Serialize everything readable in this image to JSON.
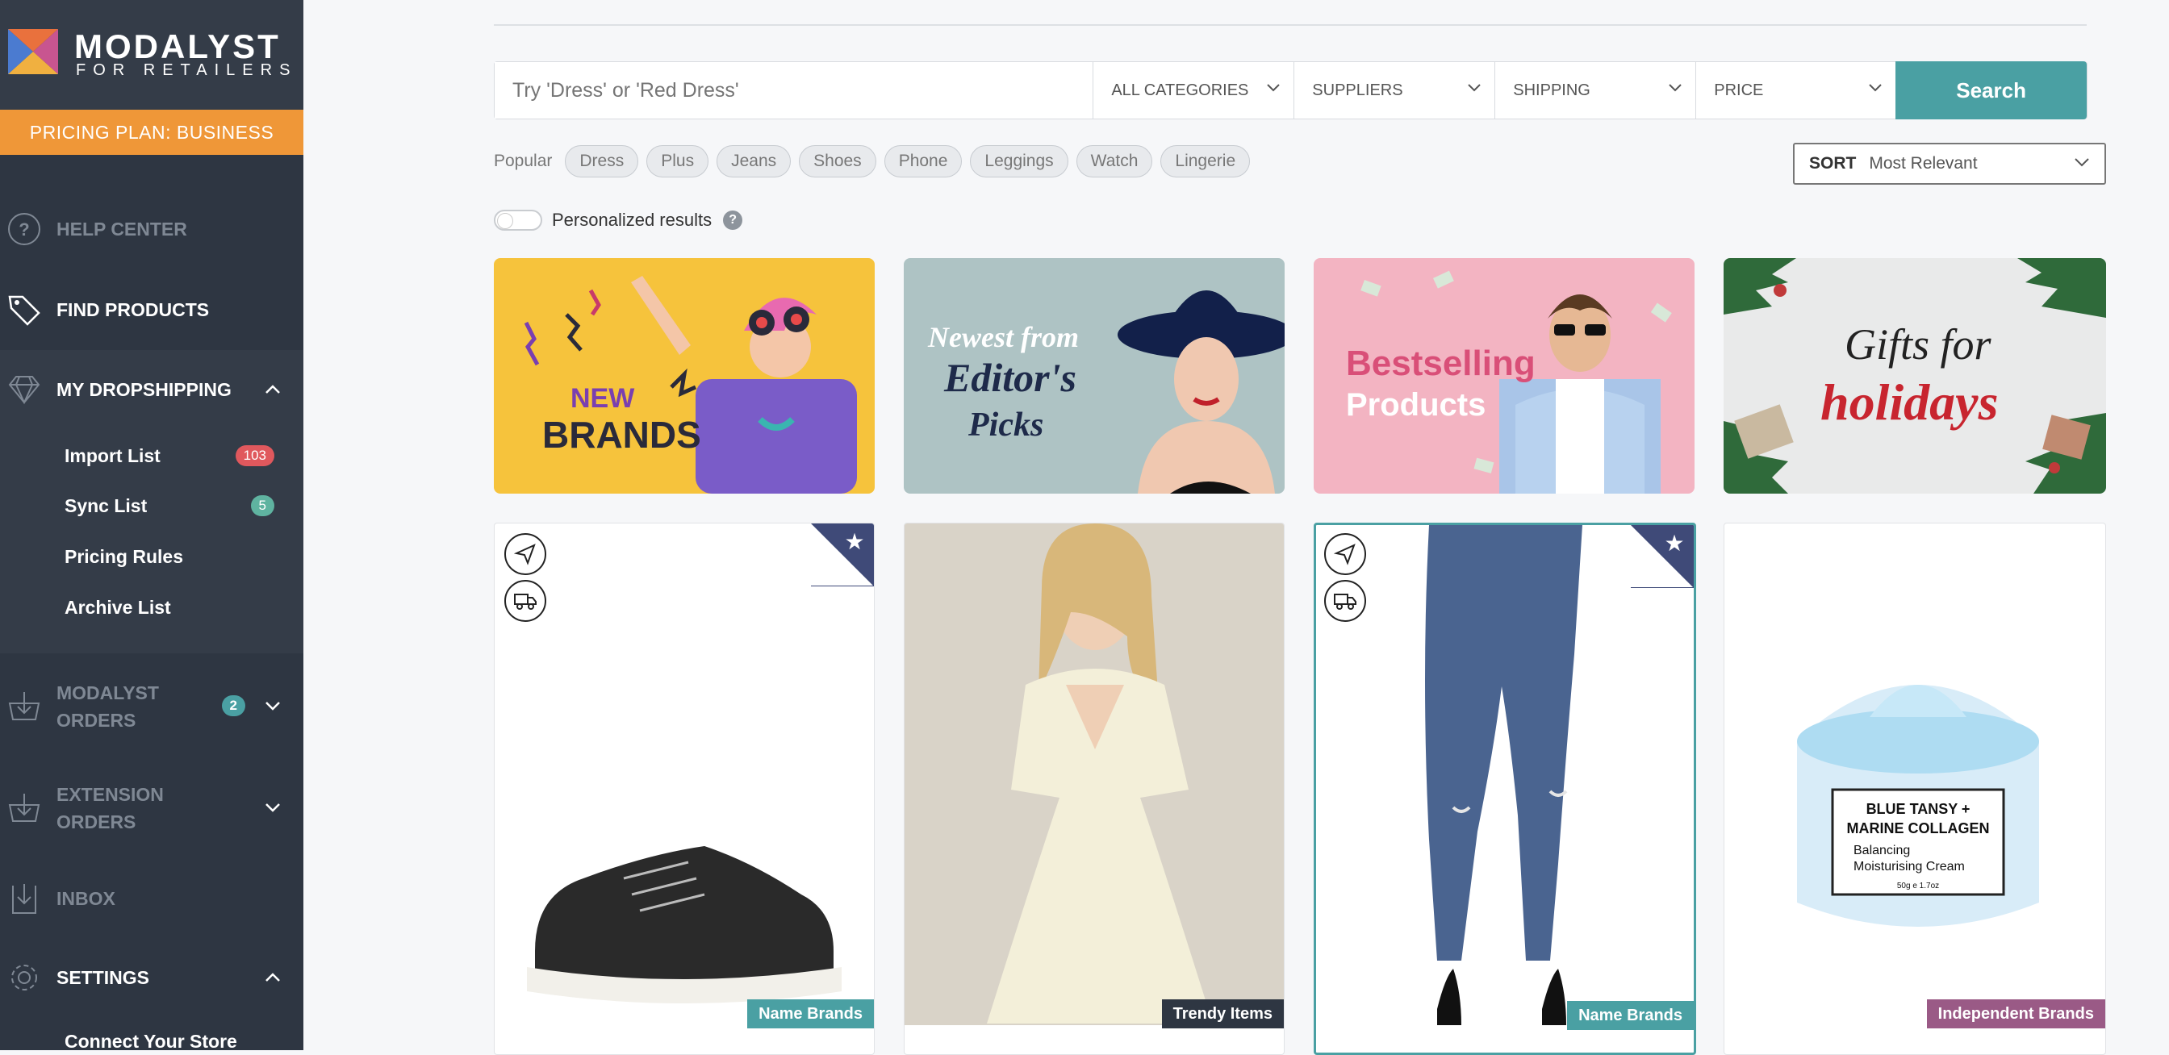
{
  "brand": {
    "name": "MODALYST",
    "sub": "FOR RETAILERS"
  },
  "plan": "PRICING PLAN: BUSINESS",
  "sidebar": {
    "help": "HELP CENTER",
    "find": "FIND PRODUCTS",
    "dropshipping": "MY DROPSHIPPING",
    "sub_items": [
      {
        "label": "Import List",
        "badge": "103"
      },
      {
        "label": "Sync List",
        "badge": "5"
      },
      {
        "label": "Pricing Rules"
      },
      {
        "label": "Archive List"
      }
    ],
    "modalyst_orders": {
      "line1": "MODALYST",
      "line2": "ORDERS",
      "badge": "2"
    },
    "extension_orders": {
      "line1": "EXTENSION",
      "line2": "ORDERS"
    },
    "inbox": "INBOX",
    "settings": "SETTINGS",
    "connect": "Connect Your Store"
  },
  "search": {
    "placeholder": "Try 'Dress' or 'Red Dress'",
    "filters": [
      "ALL CATEGORIES",
      "SUPPLIERS",
      "SHIPPING",
      "PRICE"
    ],
    "button": "Search"
  },
  "popular": {
    "label": "Popular",
    "chips": [
      "Dress",
      "Plus",
      "Jeans",
      "Shoes",
      "Phone",
      "Leggings",
      "Watch",
      "Lingerie"
    ]
  },
  "sort": {
    "label": "SORT",
    "value": "Most Relevant"
  },
  "personalized": "Personalized results",
  "banners": [
    {
      "line1": "NEW",
      "line2": "BRANDS"
    },
    {
      "line1": "Newest from",
      "line2": "Editor's",
      "line3": "Picks"
    },
    {
      "line1": "Bestselling",
      "line2": "Products"
    },
    {
      "line1": "Gifts for",
      "line2": "holidays"
    }
  ],
  "products": [
    {
      "tag": "Name Brands",
      "tag_color": "#4aa0a3"
    },
    {
      "tag": "Trendy Items",
      "tag_color": "#2e3642"
    },
    {
      "tag": "Name Brands",
      "tag_color": "#4aa0a3"
    },
    {
      "tag": "Independent Brands",
      "tag_color": "#9a5a86",
      "jar_line1": "BLUE TANSY +",
      "jar_line2": "MARINE COLLAGEN",
      "jar_line3": "Balancing",
      "jar_line4": "Moisturising Cream",
      "jar_line5": "50g e 1.7oz"
    }
  ],
  "colors": {
    "accent": "#4aa0a3",
    "plan": "#ef9738",
    "sidebar": "#2e3642",
    "badge_red": "#e0585d"
  }
}
